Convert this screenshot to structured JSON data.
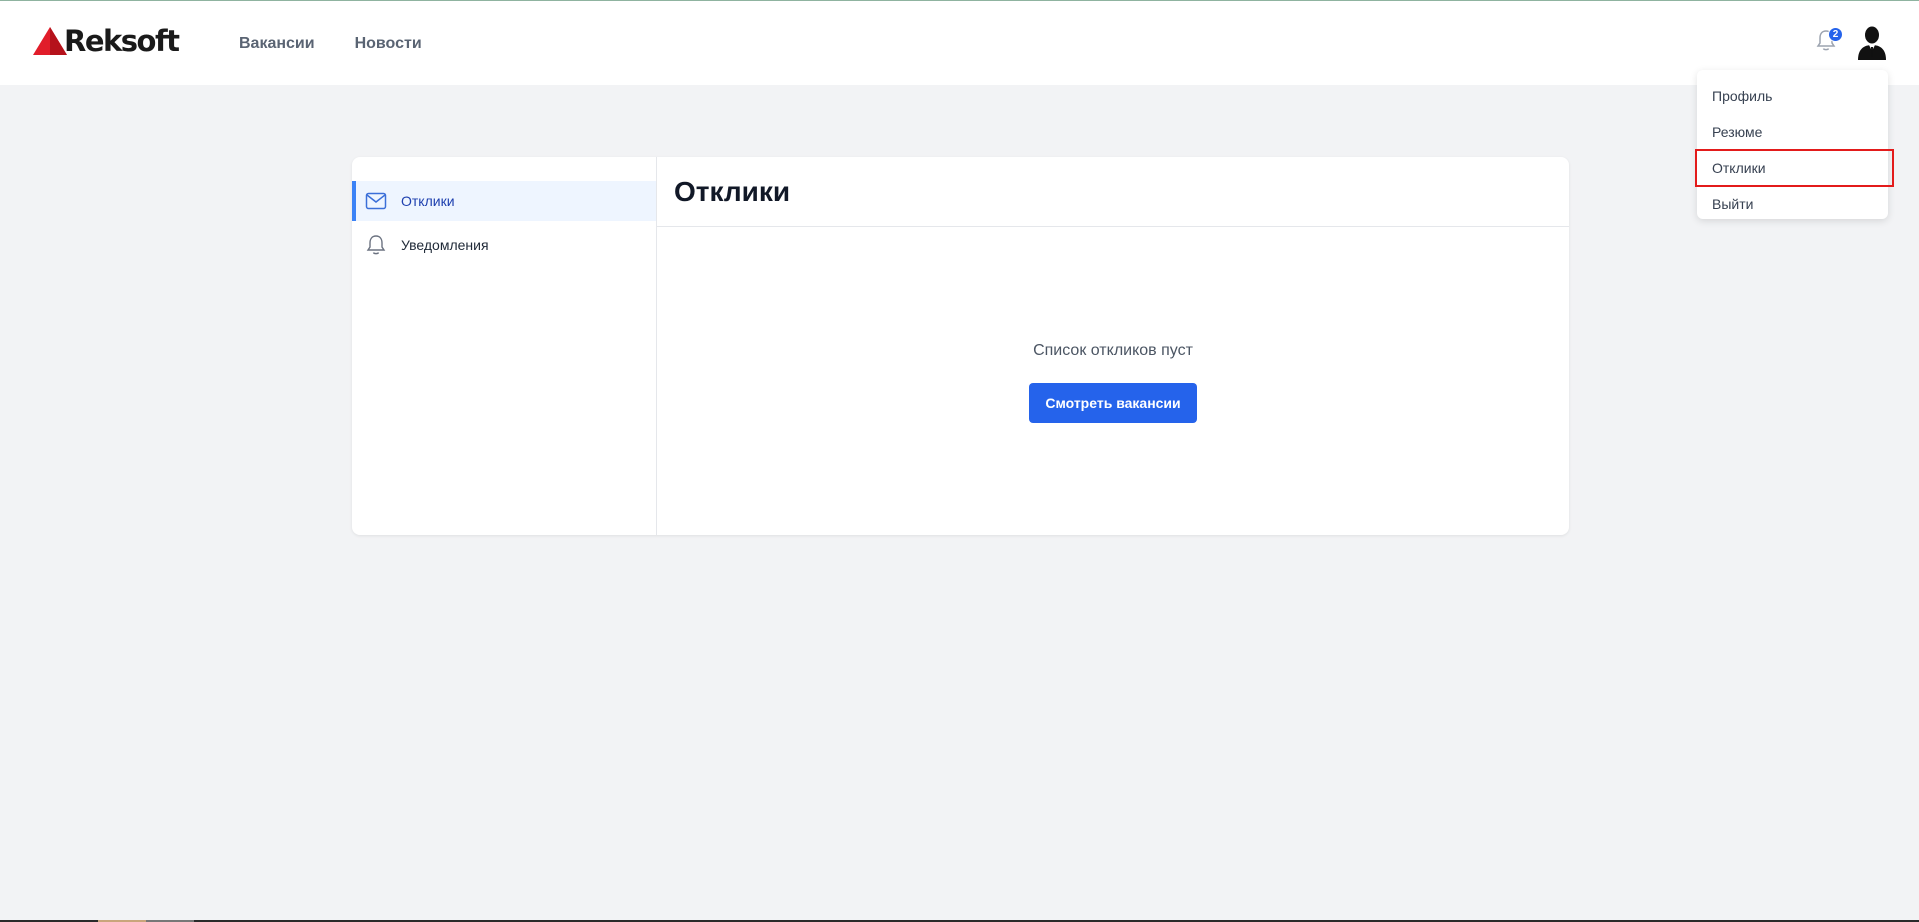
{
  "header": {
    "logo_text": "Reksoft",
    "nav": [
      "Вакансии",
      "Новости"
    ],
    "notifications_count": "2"
  },
  "dropdown": {
    "items": [
      "Профиль",
      "Резюме",
      "Отклики",
      "Выйти"
    ],
    "highlighted": "Отклики",
    "highlight_color": "#e31b1b"
  },
  "sidebar": {
    "items": [
      {
        "label": "Отклики",
        "icon": "mail-icon",
        "active": true
      },
      {
        "label": "Уведомления",
        "icon": "bell-icon",
        "active": false
      }
    ]
  },
  "main": {
    "title": "Отклики",
    "empty_text": "Список откликов пуст",
    "button_label": "Смотреть вакансии"
  },
  "colors": {
    "accent": "#2563eb",
    "logo_red": "#e11d2a",
    "background": "#f2f3f5"
  }
}
